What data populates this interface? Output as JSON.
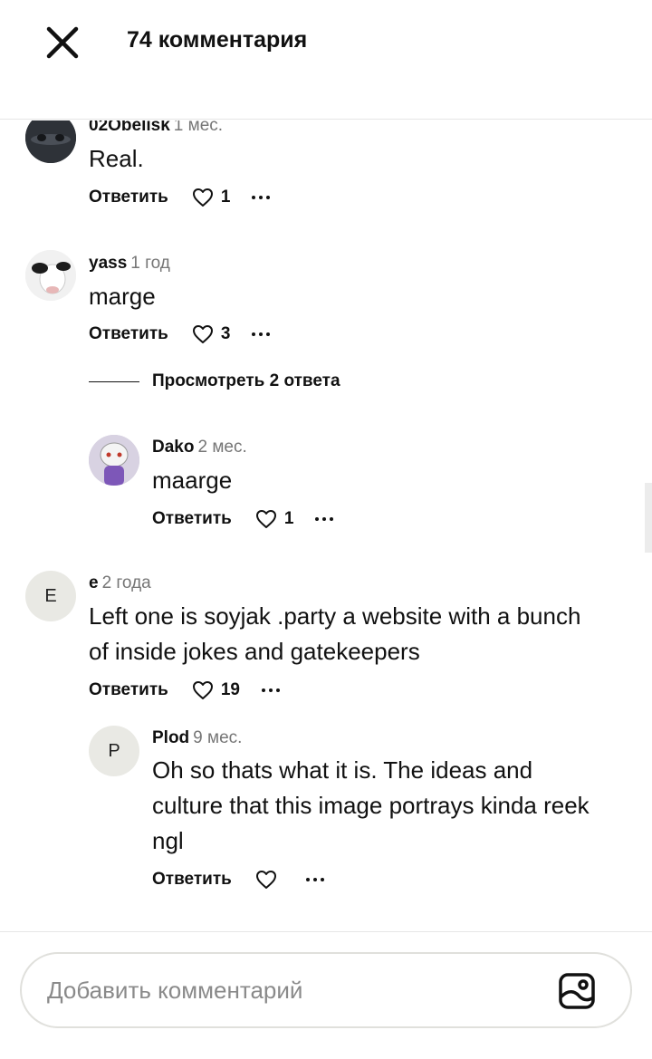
{
  "header": {
    "title": "74 комментария"
  },
  "actions_labels": {
    "reply": "Ответить"
  },
  "comments": [
    {
      "author": "02Obelisk",
      "time": "1 мес.",
      "text": "Real.",
      "likes": "1"
    },
    {
      "author": "yass",
      "time": "1 год",
      "text": "marge",
      "likes": "3",
      "view_replies": "Просмотреть 2 ответа"
    },
    {
      "author": "Dako",
      "time": "2 мес.",
      "text": "maarge",
      "likes": "1"
    },
    {
      "author": "e",
      "initial": "E",
      "time": "2 года",
      "text": "Left one is soyjak .party a website with a bunch of inside jokes and gatekeepers",
      "likes": "19"
    },
    {
      "author": "Plod",
      "initial": "P",
      "time": "9 мес.",
      "text": "Oh so thats what it is. The ideas and culture that this image portrays kinda reek ngl",
      "likes": ""
    }
  ],
  "composer": {
    "placeholder": "Добавить комментарий"
  },
  "colors": {
    "text": "#111111",
    "muted": "#767676",
    "border": "#e0e0dc",
    "avatar_bg": "#e9e9e4"
  },
  "icons": [
    "close-icon",
    "heart-icon",
    "more-icon",
    "image-icon"
  ]
}
